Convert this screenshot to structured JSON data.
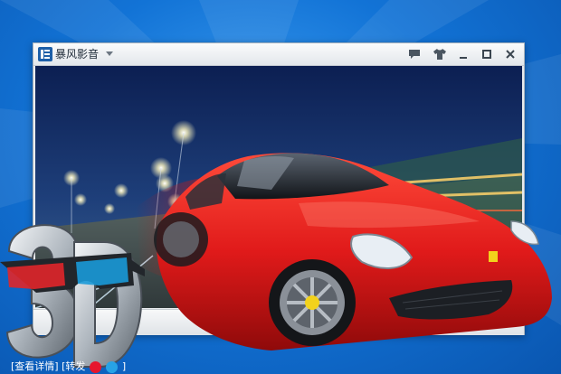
{
  "window": {
    "app_name": "暴风影音",
    "menu_icon": "chevron-down-icon",
    "title_buttons": [
      "chat-bubble-icon",
      "tshirt-skin-icon",
      "minimize-icon",
      "maximize-icon",
      "close-icon"
    ]
  },
  "controls": {
    "buttons": [
      "stop-icon",
      "previous-icon"
    ]
  },
  "links": {
    "details": "[查看详情]",
    "share": "[转发",
    "share_close": "]",
    "share_icons": [
      "weibo-icon",
      "tencent-weibo-icon"
    ]
  },
  "colors": {
    "background": "#1273d6",
    "car_red": "#e01a1a",
    "title_text": "#1f2b38",
    "link_text": "#ffffff"
  }
}
